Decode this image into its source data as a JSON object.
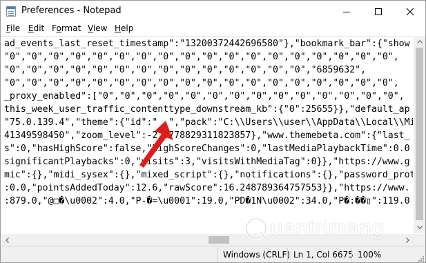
{
  "window": {
    "title": "Preferences - Notepad",
    "icon": "notepad-icon"
  },
  "caption_buttons": [
    {
      "name": "minimize-icon"
    },
    {
      "name": "maximize-icon"
    },
    {
      "name": "close-icon"
    }
  ],
  "menu": [
    {
      "mnemonic": "F",
      "rest": "ile"
    },
    {
      "mnemonic": "E",
      "rest": "dit"
    },
    {
      "pre": "F",
      "mnemonic": "o",
      "rest": "rmat"
    },
    {
      "mnemonic": "V",
      "rest": "iew"
    },
    {
      "mnemonic": "H",
      "rest": "elp"
    }
  ],
  "editor": {
    "lines": [
      "ad_events_last_reset_timestamp\":\"13200372442696580\"},\"bookmark_bar\":{\"show",
      "\"0\",\"0\",\"0\",\"0\",\"0\",\"0\",\"0\",\"0\",\"0\",\"0\",\"0\",\"0\",\"0\",\"0\",\"0\",\"0\",\"0\",\"0\",",
      "\"0\",\"0\",\"0\",\"0\",\"0\",\"0\",\"0\",\"0\",\"0\",\"0\",\"0\",\"0\",\"0\",\"0\",\"6859632\",",
      "\"0\",\"0\",\"0\",\"0\",\"0\",\"0\",\"0\",\"0\",\"0\",\"0\",\"0\",\"0\",\"0\",\"0\",\"0\",\"0\",\"0\",\"0\",",
      "_proxy_enabled\":[\"0\",\"0\",\"0\",\"0\",\"0\",\"0\",\"0\",\"0\",\"0\",\"0\",\"0\",\"0\",\"0\",\"0\",",
      "this_week_user_traffic_contenttype_downstream_kb\":{\"0\":25655}},\"default_ap",
      "\"75.0.139.4\",\"theme\":{\"id\":\"  \",\"pack\":\"C:\\\\Users\\\\user\\\\AppData\\\\Local\\\\Mi",
      "41349598450\",\"zoom_level\":-2.5778829311823857},\"www.themebeta.com\":{\"last_",
      "s\":0,\"hasHighScore\":false,\"highScoreChanges\":0,\"lastMediaPlaybackTime\":0.0",
      "significantPlaybacks\":0,\"visits\":3,\"visitsWithMediaTag\":0}},\"https://www.g",
      "mic\":{},\"midi_sysex\":{},\"mixed_script\":{},\"notifications\":{},\"password_prot",
      ":0.0,\"pointsAddedToday\":12.6,\"rawScore\":16.248789364757553}},\"https://www.",
      ":879.0,\"@□�\\u0002\":4.0,\"P-�=\\u0001\":19.0,\"PD�1N\\u0002\":34.0,\"P�:��▯\":119.0"
    ]
  },
  "status": {
    "line_ending": "Windows (CRLF)",
    "position": "Ln 1, Col 6675",
    "zoom": "100%"
  },
  "watermark": {
    "text": "uantrimang",
    "logo": "quantrimang-logo"
  },
  "annotation": {
    "name": "red-arrow-pointer",
    "color": "#e01b1b"
  }
}
